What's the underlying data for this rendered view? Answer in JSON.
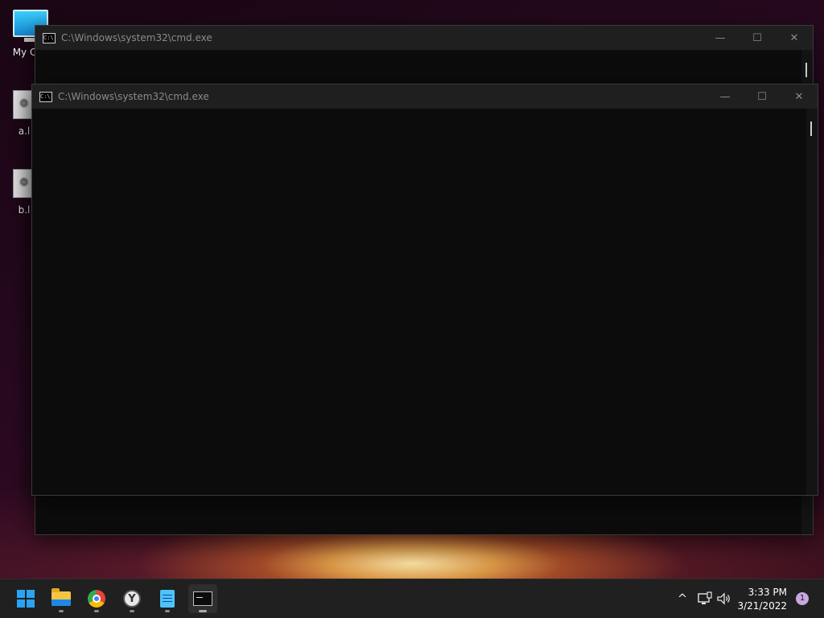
{
  "desktop": {
    "icons": [
      {
        "label": "My Con"
      },
      {
        "label": "a.l"
      },
      {
        "label": "b.l"
      }
    ]
  },
  "windows": {
    "back": {
      "title": "C:\\Windows\\system32\\cmd.exe"
    },
    "front": {
      "title": "C:\\Windows\\system32\\cmd.exe"
    }
  },
  "window_buttons": {
    "minimize": "—",
    "maximize": "☐",
    "close": "✕"
  },
  "taskbar": {
    "apps": [
      {
        "name": "start-icon"
      },
      {
        "name": "file-explorer-icon"
      },
      {
        "name": "chrome-icon"
      },
      {
        "name": "yandex-browser-icon"
      },
      {
        "name": "notepad-icon"
      },
      {
        "name": "terminal-icon",
        "active": true
      }
    ],
    "tray": {
      "chevron": "^",
      "time": "3:33 PM",
      "date": "3/21/2022",
      "notifications": "1"
    }
  }
}
